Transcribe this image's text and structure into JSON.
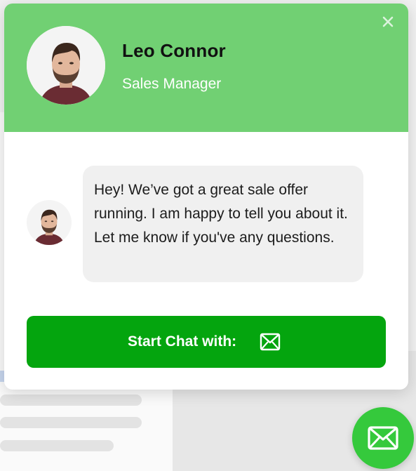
{
  "agent": {
    "name": "Leo Connor",
    "role": "Sales Manager"
  },
  "message": {
    "text": "Hey! We’ve got a great sale offer running. I am happy to tell you about it. Let me know if you've any questions."
  },
  "actions": {
    "start_chat_label": "Start Chat with:",
    "start_chat_icon": "envelope-icon",
    "close_icon": "close-icon",
    "launcher_icon": "envelope-icon"
  },
  "colors": {
    "header_bg": "#71d073",
    "button_bg": "#04a50e",
    "launcher_bg": "#35c93c",
    "bubble_bg": "#f0f0f0"
  }
}
